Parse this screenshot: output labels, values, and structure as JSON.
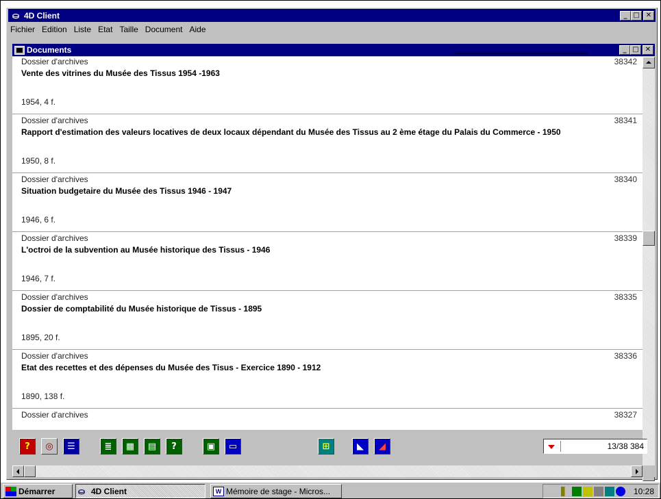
{
  "app": {
    "title": "4D Client",
    "window_buttons": [
      "_",
      "□",
      "✕"
    ]
  },
  "menu": [
    {
      "label": "Fichier",
      "name": "fichier"
    },
    {
      "label": "Edition",
      "name": "edition"
    },
    {
      "label": "Liste",
      "name": "liste"
    },
    {
      "label": "Etat",
      "name": "etat"
    },
    {
      "label": "Taille",
      "name": "taille"
    },
    {
      "label": "Document",
      "name": "document"
    },
    {
      "label": "Aide",
      "name": "aide"
    }
  ],
  "doc_window": {
    "title": "Documents",
    "window_buttons": [
      "_",
      "□",
      "✕"
    ]
  },
  "records": [
    {
      "type": "Dossier d'archives",
      "id": "38342",
      "title": "Vente des vitrines du Musée des Tissus 1954 -1963",
      "meta": "1954, 4 f."
    },
    {
      "type": "Dossier d'archives",
      "id": "38341",
      "title": "Rapport d'estimation des valeurs locatives de deux locaux dépendant du Musée des Tissus au 2 ème étage du Palais du Commerce - 1950",
      "meta": "1950, 8 f."
    },
    {
      "type": "Dossier d'archives",
      "id": "38340",
      "title": "Situation budgetaire du Musée des Tissus 1946 - 1947",
      "meta": "1946, 6 f."
    },
    {
      "type": "Dossier d'archives",
      "id": "38339",
      "title": "L'octroi de la subvention au Musée historique des Tissus - 1946",
      "meta": "1946, 7 f."
    },
    {
      "type": "Dossier d'archives",
      "id": "38335",
      "title": "Dossier de comptabilité du Musée historique de Tissus - 1895",
      "meta": "1895, 20 f."
    },
    {
      "type": "Dossier d'archives",
      "id": "38336",
      "title": "Etat des recettes et des dépenses du Musée des Tisus - Exercice 1890 - 1912",
      "meta": "1890, 138 f."
    },
    {
      "type": "Dossier d'archives",
      "id": "38327",
      "title": "",
      "meta": ""
    }
  ],
  "scrollbar": {
    "position_fraction": 0.42
  },
  "toolbar": {
    "buttons": [
      {
        "icon": "help-icon",
        "glyph": "?",
        "bg": "#c00000",
        "fg": "#ffff00"
      },
      {
        "icon": "target-icon",
        "glyph": "◎",
        "bg": "#c0c0c0",
        "fg": "#800000"
      },
      {
        "icon": "list-icon",
        "glyph": "☰",
        "bg": "#0000a0",
        "fg": "#ffffff"
      },
      {
        "icon": "report-icon",
        "glyph": "≣",
        "bg": "#006000",
        "fg": "#ffffff"
      },
      {
        "icon": "table-icon",
        "glyph": "▦",
        "bg": "#006000",
        "fg": "#ffffff"
      },
      {
        "icon": "form-icon",
        "glyph": "▤",
        "bg": "#006000",
        "fg": "#ffffff"
      },
      {
        "icon": "query-icon",
        "glyph": "?",
        "bg": "#006000",
        "fg": "#ffffff"
      },
      {
        "icon": "export-icon",
        "glyph": "▣",
        "bg": "#006000",
        "fg": "#ffffff"
      },
      {
        "icon": "save-icon",
        "glyph": "▭",
        "bg": "#0000c0",
        "fg": "#ffffff"
      },
      {
        "icon": "grid-icon",
        "glyph": "⊞",
        "bg": "#008080",
        "fg": "#ffff00"
      },
      {
        "icon": "chart-icon",
        "glyph": "◣",
        "bg": "#0000c0",
        "fg": "#ffffff"
      },
      {
        "icon": "graph-icon",
        "glyph": "◢",
        "bg": "#0000c0",
        "fg": "#ff4040"
      }
    ],
    "counter": "13/38 384"
  },
  "taskbar": {
    "start_label": "Démarrer",
    "tasks": [
      {
        "label": "4D Client",
        "active": true
      },
      {
        "label": "Mémoire de stage - Micros...",
        "active": false
      }
    ],
    "clock": "10:28"
  },
  "colors": {
    "titlebar": "#000080",
    "face": "#c0c0c0",
    "counter_arrow": "#e00000"
  }
}
